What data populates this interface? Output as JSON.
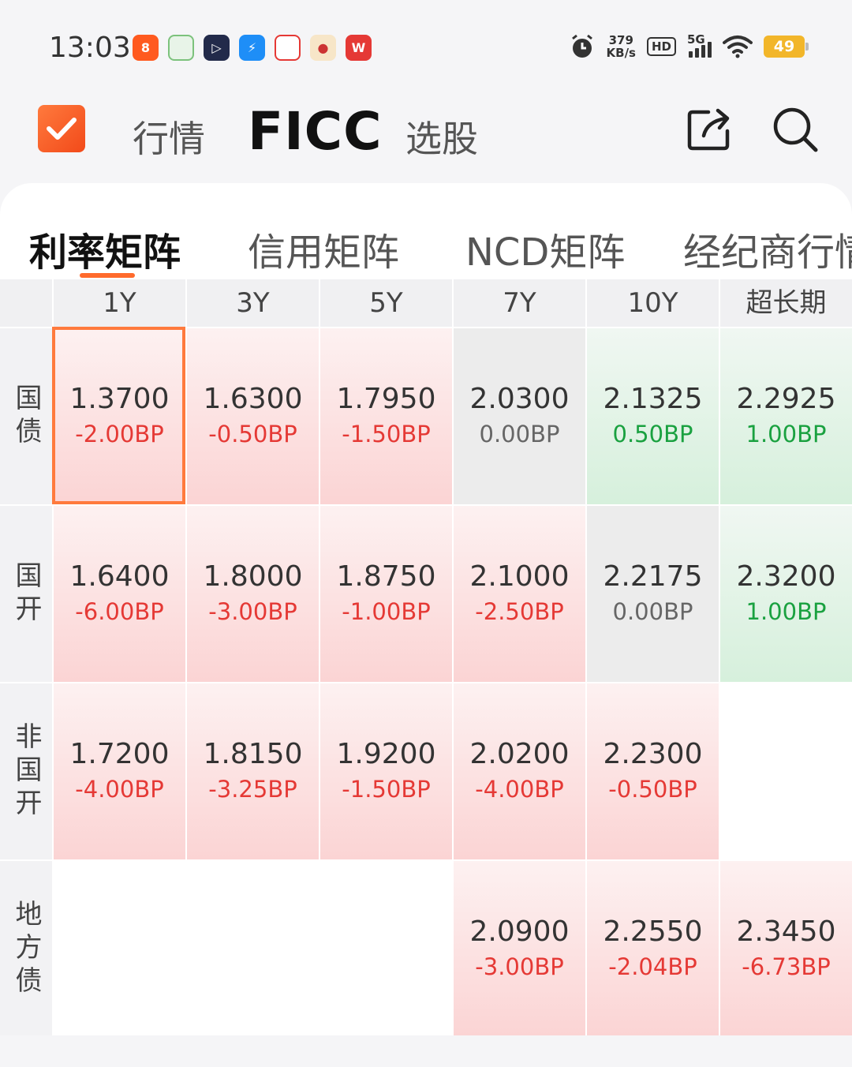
{
  "status": {
    "time": "13:03",
    "net_speed_value": "379",
    "net_speed_unit": "KB/s",
    "hd": "HD",
    "network": "5G",
    "battery": "49"
  },
  "nav": {
    "tabs": [
      "行情",
      "FICC",
      "选股"
    ],
    "active_tab": "FICC"
  },
  "sub_tabs": [
    "利率矩阵",
    "信用矩阵",
    "NCD矩阵",
    "经纪商行情"
  ],
  "matrix": {
    "columns": [
      "1Y",
      "3Y",
      "5Y",
      "7Y",
      "10Y",
      "超长期"
    ],
    "rows": [
      {
        "label": "国债",
        "cells": [
          {
            "rate": "1.3700",
            "change": "-2.00BP",
            "trend": "down"
          },
          {
            "rate": "1.6300",
            "change": "-0.50BP",
            "trend": "down"
          },
          {
            "rate": "1.7950",
            "change": "-1.50BP",
            "trend": "down"
          },
          {
            "rate": "2.0300",
            "change": "0.00BP",
            "trend": "flat"
          },
          {
            "rate": "2.1325",
            "change": "0.50BP",
            "trend": "up"
          },
          {
            "rate": "2.2925",
            "change": "1.00BP",
            "trend": "up"
          }
        ]
      },
      {
        "label": "国开",
        "cells": [
          {
            "rate": "1.6400",
            "change": "-6.00BP",
            "trend": "down"
          },
          {
            "rate": "1.8000",
            "change": "-3.00BP",
            "trend": "down"
          },
          {
            "rate": "1.8750",
            "change": "-1.00BP",
            "trend": "down"
          },
          {
            "rate": "2.1000",
            "change": "-2.50BP",
            "trend": "down"
          },
          {
            "rate": "2.2175",
            "change": "0.00BP",
            "trend": "flat"
          },
          {
            "rate": "2.3200",
            "change": "1.00BP",
            "trend": "up"
          }
        ]
      },
      {
        "label": "非国开",
        "cells": [
          {
            "rate": "1.7200",
            "change": "-4.00BP",
            "trend": "down"
          },
          {
            "rate": "1.8150",
            "change": "-3.25BP",
            "trend": "down"
          },
          {
            "rate": "1.9200",
            "change": "-1.50BP",
            "trend": "down"
          },
          {
            "rate": "2.0200",
            "change": "-4.00BP",
            "trend": "down"
          },
          {
            "rate": "2.2300",
            "change": "-0.50BP",
            "trend": "down"
          },
          {
            "rate": "",
            "change": "",
            "trend": "empty"
          }
        ]
      },
      {
        "label": "地方债",
        "cells": [
          {
            "rate": "",
            "change": "",
            "trend": "empty"
          },
          {
            "rate": "",
            "change": "",
            "trend": "empty"
          },
          {
            "rate": "",
            "change": "",
            "trend": "empty"
          },
          {
            "rate": "2.0900",
            "change": "-3.00BP",
            "trend": "down"
          },
          {
            "rate": "2.2550",
            "change": "-2.04BP",
            "trend": "down"
          },
          {
            "rate": "2.3450",
            "change": "-6.73BP",
            "trend": "down"
          }
        ]
      }
    ]
  },
  "colors": {
    "accent": "#ff6a2c",
    "down": "#e53935",
    "up": "#1aa140",
    "flat": "#666666"
  }
}
